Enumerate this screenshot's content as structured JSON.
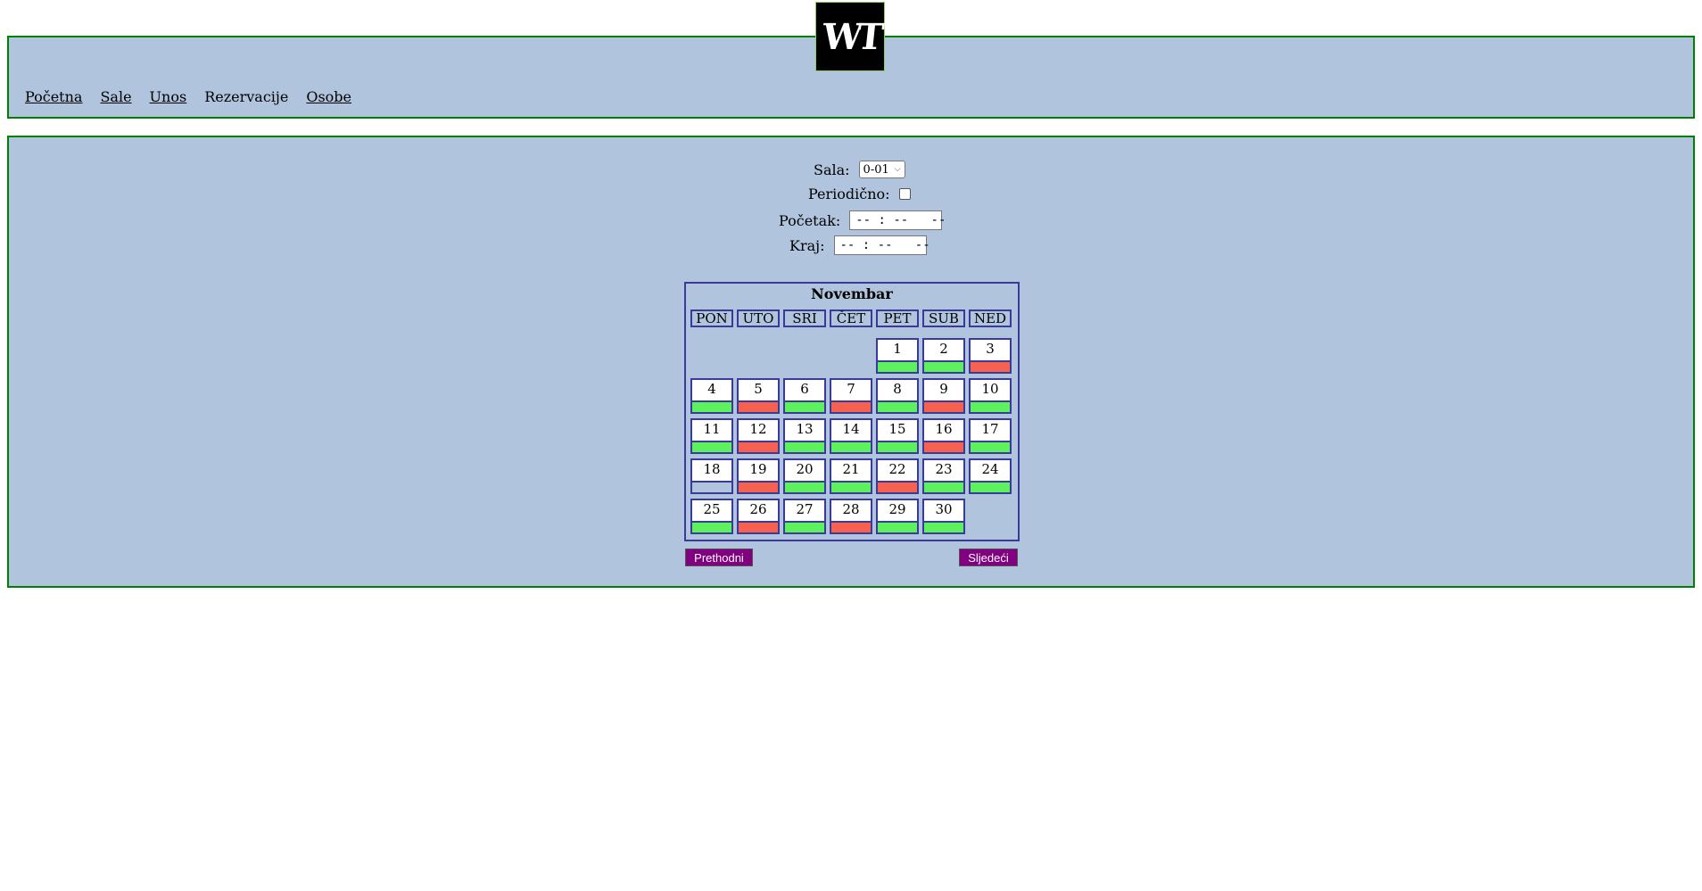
{
  "logo_text": "WT",
  "nav": {
    "items": [
      "Početna",
      "Sale",
      "Unos",
      "Rezervacije",
      "Osobe"
    ]
  },
  "form": {
    "sala_label": "Sala:",
    "sala_value": "0-01",
    "periodicno_label": "Periodično:",
    "periodicno_checked": false,
    "pocetak_label": "Početak:",
    "pocetak_value": "-- : --   --",
    "kraj_label": "Kraj:",
    "kraj_value": "-- : --   --"
  },
  "calendar": {
    "month": "Novembar",
    "weekdays": [
      "PON",
      "UTO",
      "SRI",
      "ČET",
      "PET",
      "SUB",
      "NED"
    ],
    "first_weekday_index": 4,
    "status_colors": {
      "free": "#5df15d",
      "busy": "#f6624f",
      "none": "#b0c4de"
    },
    "days": [
      {
        "day": "1",
        "status": "free"
      },
      {
        "day": "2",
        "status": "free"
      },
      {
        "day": "3",
        "status": "busy"
      },
      {
        "day": "4",
        "status": "free"
      },
      {
        "day": "5",
        "status": "busy"
      },
      {
        "day": "6",
        "status": "free"
      },
      {
        "day": "7",
        "status": "busy"
      },
      {
        "day": "8",
        "status": "free"
      },
      {
        "day": "9",
        "status": "busy"
      },
      {
        "day": "10",
        "status": "free"
      },
      {
        "day": "11",
        "status": "free"
      },
      {
        "day": "12",
        "status": "busy"
      },
      {
        "day": "13",
        "status": "free"
      },
      {
        "day": "14",
        "status": "free"
      },
      {
        "day": "15",
        "status": "free"
      },
      {
        "day": "16",
        "status": "busy"
      },
      {
        "day": "17",
        "status": "free"
      },
      {
        "day": "18",
        "status": "none"
      },
      {
        "day": "19",
        "status": "busy"
      },
      {
        "day": "20",
        "status": "free"
      },
      {
        "day": "21",
        "status": "free"
      },
      {
        "day": "22",
        "status": "busy"
      },
      {
        "day": "23",
        "status": "free"
      },
      {
        "day": "24",
        "status": "free"
      },
      {
        "day": "25",
        "status": "free"
      },
      {
        "day": "26",
        "status": "busy"
      },
      {
        "day": "27",
        "status": "free"
      },
      {
        "day": "28",
        "status": "busy"
      },
      {
        "day": "29",
        "status": "free"
      },
      {
        "day": "30",
        "status": "free"
      }
    ]
  },
  "buttons": {
    "prev": "Prethodni",
    "next": "Sljedeći"
  },
  "colors": {
    "panel": "#b0c4de",
    "border": "#008000",
    "button": "#800080"
  }
}
